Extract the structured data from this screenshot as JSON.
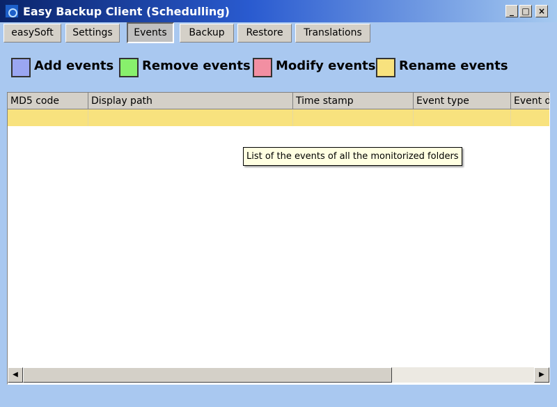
{
  "window": {
    "title": "Easy Backup Client (Schedulling)",
    "controls": {
      "minimize": "_",
      "maximize": "□",
      "close": "×"
    }
  },
  "tabs": [
    {
      "label": "easySoft",
      "active": false
    },
    {
      "label": "Settings",
      "active": false
    },
    {
      "label": "Events",
      "active": true
    },
    {
      "label": "Backup",
      "active": false
    },
    {
      "label": "Restore",
      "active": false
    },
    {
      "label": "Translations",
      "active": false
    }
  ],
  "legend": [
    {
      "label": "Add events",
      "color": "#9aa6f2"
    },
    {
      "label": "Remove events",
      "color": "#88f06c"
    },
    {
      "label": "Modify events",
      "color": "#f28fa2"
    },
    {
      "label": "Rename events",
      "color": "#f8e27e"
    }
  ],
  "grid": {
    "columns": [
      "MD5 code",
      "Display path",
      "Time stamp",
      "Event type",
      "Event d"
    ],
    "rows": [
      {
        "cells": [
          "",
          "",
          "",
          "",
          ""
        ],
        "color": "#f8e27e"
      }
    ]
  },
  "tooltip": "List of the events of all the monitorized folders",
  "scrollbar": {
    "left_arrow": "◀",
    "right_arrow": "▶"
  }
}
